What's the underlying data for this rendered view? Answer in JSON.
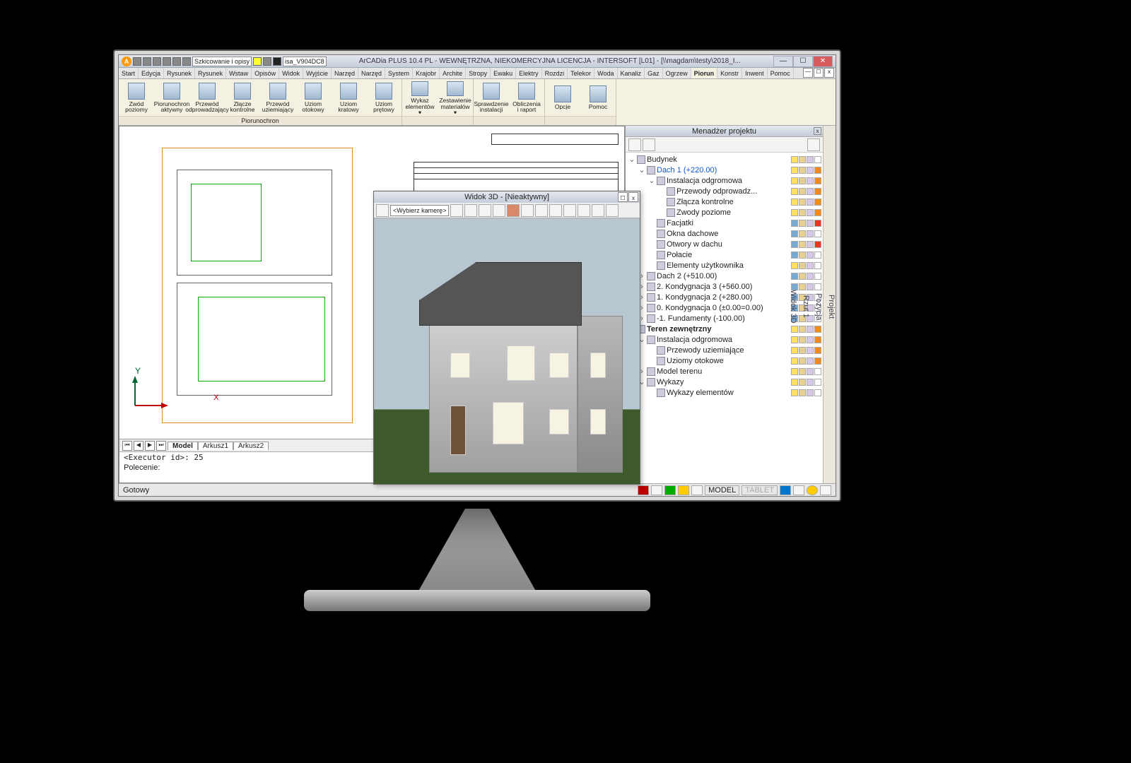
{
  "title": "ArCADia PLUS 10.4 PL - WEWNĘTRZNA, NIEKOMERCYJNA LICENCJA - INTERSOFT [L01] - [\\\\magdam\\testy\\2018_I...",
  "quick": {
    "combo": "Szkicowanie i opisy",
    "docname": "isa_V904DC8"
  },
  "tabs": [
    "Start",
    "Edycja",
    "Rysunek",
    "Rysunek",
    "Wstaw",
    "Opisów",
    "Widok",
    "Wyjście",
    "Narzęd",
    "Narzęd",
    "System",
    "Krajobr",
    "Archite",
    "Stropy",
    "Ewaku",
    "Elektry",
    "Rozdzi",
    "Telekor",
    "Woda",
    "Kanaliz",
    "Gaz",
    "Ogrzew",
    "Piorun",
    "Konstr",
    "Inwent",
    "Pomoc"
  ],
  "active_tab": "Piorun",
  "ribbon": [
    {
      "label": "Piorunochron",
      "btns": [
        [
          "Zwód",
          "poziomy"
        ],
        [
          "Piorunochron",
          "aktywny"
        ],
        [
          "Przewód",
          "odprowadzający"
        ],
        [
          "Złącze",
          "kontrolne"
        ],
        [
          "Przewód",
          "uziemiający"
        ],
        [
          "Uziom",
          "otokowy"
        ],
        [
          "Uziom",
          "kratowy"
        ],
        [
          "Uziom",
          "prętowy"
        ]
      ]
    },
    {
      "label": "",
      "btns": [
        [
          "Wykaz",
          "elementów ▾"
        ],
        [
          "Zestawienie",
          "materiałów ▾"
        ]
      ]
    },
    {
      "label": "",
      "btns": [
        [
          "Sprawdzenie",
          "instalacji"
        ],
        [
          "Obliczenia",
          "i raport"
        ]
      ]
    },
    {
      "label": "",
      "btns": [
        [
          "Opcje",
          ""
        ],
        [
          "Pomoc",
          ""
        ]
      ]
    }
  ],
  "axis": {
    "x": "X",
    "y": "Y"
  },
  "viewtabs": [
    "Model",
    "Arkusz1",
    "Arkusz2"
  ],
  "cmd": {
    "line": "<Executor id>: 25",
    "prompt": "Polecenie:"
  },
  "float": {
    "title": "Widok 3D - [Nieaktywny]",
    "combo": "<Wybierz kamerę>"
  },
  "panel_title": "Menadżer projektu",
  "side_tabs": [
    "Projekt",
    "Pozycja",
    "Rzut 1",
    "Widok 3D"
  ],
  "tree": [
    {
      "ind": 0,
      "exp": "v",
      "label": "Budynek",
      "cols": [
        "bulb",
        "lock",
        "print",
        "col wh"
      ]
    },
    {
      "ind": 1,
      "exp": "v",
      "label": "Dach 1 (+220.00)",
      "sel": true,
      "cols": [
        "bulb",
        "lock",
        "print",
        "col"
      ]
    },
    {
      "ind": 2,
      "exp": "v",
      "label": "Instalacja odgromowa",
      "cols": [
        "bulb",
        "lock",
        "print",
        "col"
      ]
    },
    {
      "ind": 3,
      "exp": "",
      "label": "Przewody odprowadz...",
      "cols": [
        "bulb",
        "lock",
        "print",
        "col"
      ]
    },
    {
      "ind": 3,
      "exp": "",
      "label": "Złącza kontrolne",
      "cols": [
        "bulb",
        "lock",
        "print",
        "col"
      ]
    },
    {
      "ind": 3,
      "exp": "",
      "label": "Zwody poziome",
      "cols": [
        "bulb",
        "lock",
        "print",
        "col"
      ]
    },
    {
      "ind": 2,
      "exp": "",
      "label": "Facjatki",
      "cols": [
        "bulb off",
        "lock",
        "print",
        "col red"
      ]
    },
    {
      "ind": 2,
      "exp": "",
      "label": "Okna dachowe",
      "cols": [
        "bulb off",
        "lock",
        "print",
        "col wh"
      ]
    },
    {
      "ind": 2,
      "exp": "",
      "label": "Otwory w dachu",
      "cols": [
        "bulb off",
        "lock",
        "print",
        "col red"
      ]
    },
    {
      "ind": 2,
      "exp": "",
      "label": "Połacie",
      "cols": [
        "bulb off",
        "lock",
        "print",
        "col wh"
      ]
    },
    {
      "ind": 2,
      "exp": "",
      "label": "Elementy użytkownika",
      "cols": [
        "bulb",
        "lock",
        "print",
        "col wh"
      ]
    },
    {
      "ind": 1,
      "exp": ">",
      "label": "Dach 2 (+510.00)",
      "cols": [
        "bulb off",
        "lock",
        "print",
        "col wh"
      ]
    },
    {
      "ind": 1,
      "exp": ">",
      "label": "2. Kondygnacja 3 (+560.00)",
      "cols": [
        "bulb off",
        "lock",
        "print",
        "col wh"
      ]
    },
    {
      "ind": 1,
      "exp": ">",
      "label": "1. Kondygnacja 2 (+280.00)",
      "cols": [
        "bulb off",
        "lock",
        "print",
        "col wh"
      ]
    },
    {
      "ind": 1,
      "exp": ">",
      "label": "0. Kondygnacja 0 (±0.00=0.00)",
      "cols": [
        "bulb off",
        "lock",
        "print",
        "col wh"
      ]
    },
    {
      "ind": 1,
      "exp": ">",
      "label": "-1. Fundamenty (-100.00)",
      "cols": [
        "bulb off",
        "lock",
        "print",
        "col wh"
      ]
    },
    {
      "ind": 0,
      "exp": "v",
      "label": "Teren zewnętrzny",
      "bold": true,
      "cols": [
        "bulb",
        "lock",
        "print",
        "col"
      ]
    },
    {
      "ind": 1,
      "exp": "v",
      "label": "Instalacja odgromowa",
      "cols": [
        "bulb",
        "lock",
        "print",
        "col"
      ]
    },
    {
      "ind": 2,
      "exp": "",
      "label": "Przewody uziemiające",
      "cols": [
        "bulb",
        "lock",
        "print",
        "col"
      ]
    },
    {
      "ind": 2,
      "exp": "",
      "label": "Uziomy otokowe",
      "cols": [
        "bulb",
        "lock",
        "print",
        "col"
      ]
    },
    {
      "ind": 1,
      "exp": ">",
      "label": "Model terenu",
      "cols": [
        "bulb",
        "lock",
        "print",
        "col wh"
      ]
    },
    {
      "ind": 1,
      "exp": "v",
      "label": "Wykazy",
      "cols": [
        "bulb",
        "lock",
        "print",
        "col wh"
      ]
    },
    {
      "ind": 2,
      "exp": "",
      "label": "Wykazy elementów",
      "cols": [
        "bulb",
        "lock",
        "print",
        "col wh"
      ]
    }
  ],
  "status": {
    "left": "Gotowy",
    "model": "MODEL",
    "tablet": "TABLET"
  }
}
